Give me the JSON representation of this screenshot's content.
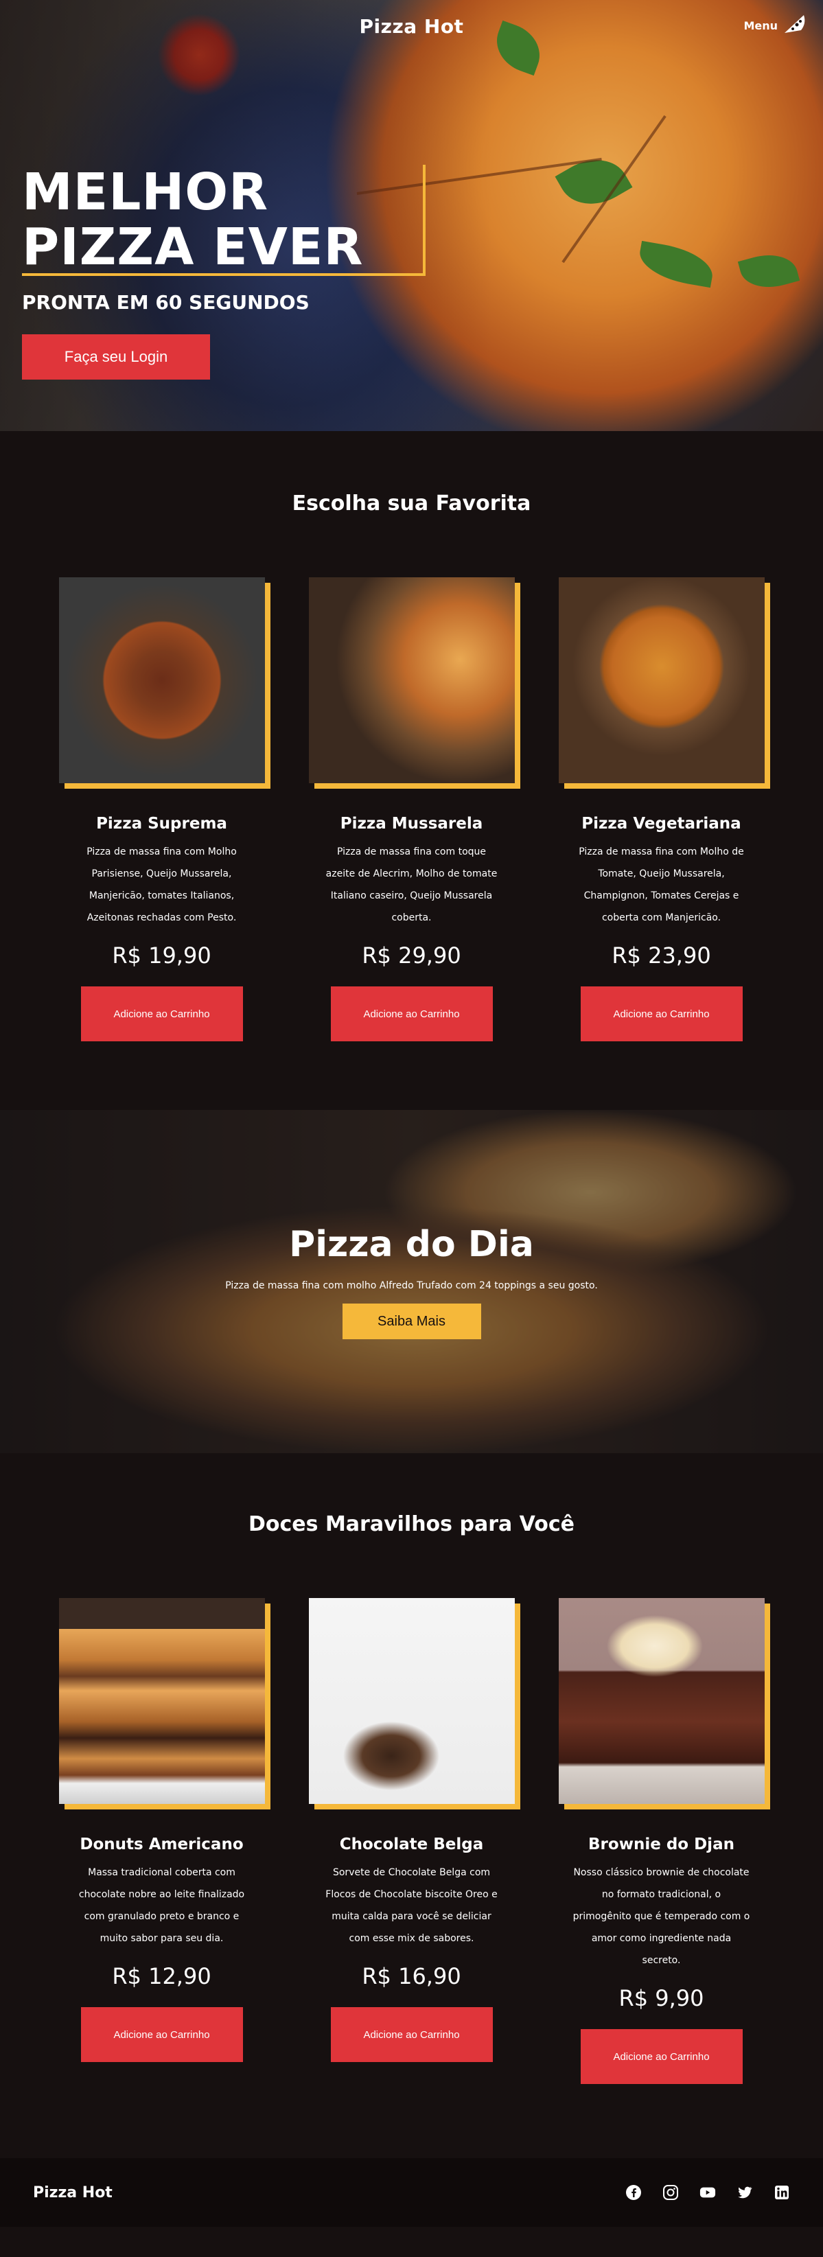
{
  "hero": {
    "brand": "Pizza Hot",
    "menu_label": "Menu",
    "title_line1": "MELHOR",
    "title_line2": "PIZZA EVER",
    "subtitle": "PRONTA EM 60 SEGUNDOS",
    "login_button": "Faça seu Login"
  },
  "favorites": {
    "title": "Escolha sua Favorita",
    "items": [
      {
        "name": "Pizza Suprema",
        "description": "Pizza de massa fina com Molho Parisiense, Queijo Mussarela, Manjericão, tomates Italianos, Azeitonas rechadas com Pesto.",
        "price": "R$ 19,90",
        "button": "Adicione ao Carrinho"
      },
      {
        "name": "Pizza Mussarela",
        "description": "Pizza de massa fina com toque azeite de Alecrim, Molho de tomate Italiano caseiro, Queijo Mussarela coberta.",
        "price": "R$ 29,90",
        "button": "Adicione ao Carrinho"
      },
      {
        "name": "Pizza Vegetariana",
        "description": "Pizza de massa fina com Molho de Tomate, Queijo Mussarela, Champignon, Tomates Cerejas e coberta com Manjericão.",
        "price": "R$ 23,90",
        "button": "Adicione ao Carrinho"
      }
    ]
  },
  "pizza_of_day": {
    "title": "Pizza do Dia",
    "description": "Pizza de massa fina com molho Alfredo Trufado com 24 toppings a seu gosto.",
    "button": "Saiba Mais"
  },
  "desserts": {
    "title": "Doces Maravilhos para Você",
    "items": [
      {
        "name": "Donuts Americano",
        "description": "Massa tradicional coberta com chocolate nobre ao leite finalizado com granulado preto e branco e muito sabor para seu dia.",
        "price": "R$ 12,90",
        "button": "Adicione ao Carrinho"
      },
      {
        "name": "Chocolate Belga",
        "description": "Sorvete de Chocolate Belga com Flocos de Chocolate biscoite Oreo e muita calda para você se deliciar com esse mix de sabores.",
        "price": "R$ 16,90",
        "button": "Adicione ao Carrinho"
      },
      {
        "name": "Brownie do Djan",
        "description": "Nosso clássico brownie de chocolate no formato tradicional, o primogênito que é temperado com o amor como ingrediente nada secreto.",
        "price": "R$ 9,90",
        "button": "Adicione ao Carrinho"
      }
    ]
  },
  "footer": {
    "brand": "Pizza Hot",
    "social_icons": [
      "facebook-icon",
      "instagram-icon",
      "youtube-icon",
      "twitter-icon",
      "linkedin-icon"
    ]
  },
  "colors": {
    "background": "#161010",
    "accent_red": "#e0353a",
    "accent_yellow": "#f5b83a"
  }
}
